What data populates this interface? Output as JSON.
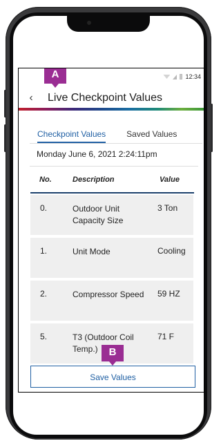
{
  "status_bar": {
    "time": "12:34"
  },
  "badges": {
    "a": "A",
    "b": "B"
  },
  "header": {
    "back_icon": "chevron-left",
    "title": "Live Checkpoint Values"
  },
  "tabs": [
    {
      "label": "Checkpoint Values",
      "active": true
    },
    {
      "label": "Saved Values",
      "active": false
    }
  ],
  "date_text": "Monday June 6, 2021 2:24:11pm",
  "table": {
    "headers": {
      "no": "No.",
      "description": "Description",
      "value": "Value"
    },
    "rows": [
      {
        "no": "0.",
        "description": "Outdoor Unit Capacity Size",
        "value": "3 Ton"
      },
      {
        "no": "1.",
        "description": "Unit Mode",
        "value": "Cooling"
      },
      {
        "no": "2.",
        "description": "Compressor Speed",
        "value": "59 HZ"
      },
      {
        "no": "5.",
        "description": "T3 (Outdoor Coil Temp.)",
        "value": "71 F"
      }
    ]
  },
  "save_button": {
    "label": "Save Values"
  },
  "colors": {
    "accent": "#1f5fa3",
    "badge": "#9a2d93",
    "table_divider": "#1b3f6b"
  }
}
